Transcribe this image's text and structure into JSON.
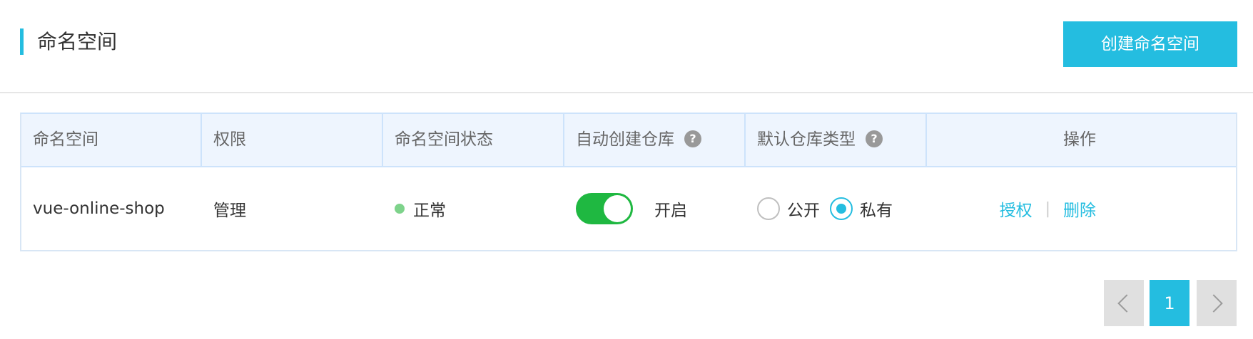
{
  "colors": {
    "accent": "#24bde0",
    "switch_on": "#1fb841",
    "status_ok": "#7ed38b",
    "header_bg": "#eef5fe"
  },
  "header": {
    "title": "命名空间",
    "create_button": "创建命名空间"
  },
  "table": {
    "columns": [
      {
        "label": "命名空间"
      },
      {
        "label": "权限"
      },
      {
        "label": "命名空间状态"
      },
      {
        "label": "自动创建仓库",
        "help_icon": "question-mark-icon"
      },
      {
        "label": "默认仓库类型",
        "help_icon": "question-mark-icon"
      },
      {
        "label": "操作"
      }
    ],
    "rows": [
      {
        "name": "vue-online-shop",
        "permission": "管理",
        "status": "正常",
        "auto_create": {
          "on": true,
          "label": "开启"
        },
        "repo_type": {
          "options": [
            "公开",
            "私有"
          ],
          "selected": "私有"
        },
        "actions": [
          "授权",
          "删除"
        ]
      }
    ]
  },
  "pagination": {
    "prev_icon": "chevron-left-icon",
    "current_page": "1",
    "next_icon": "chevron-right-icon"
  }
}
